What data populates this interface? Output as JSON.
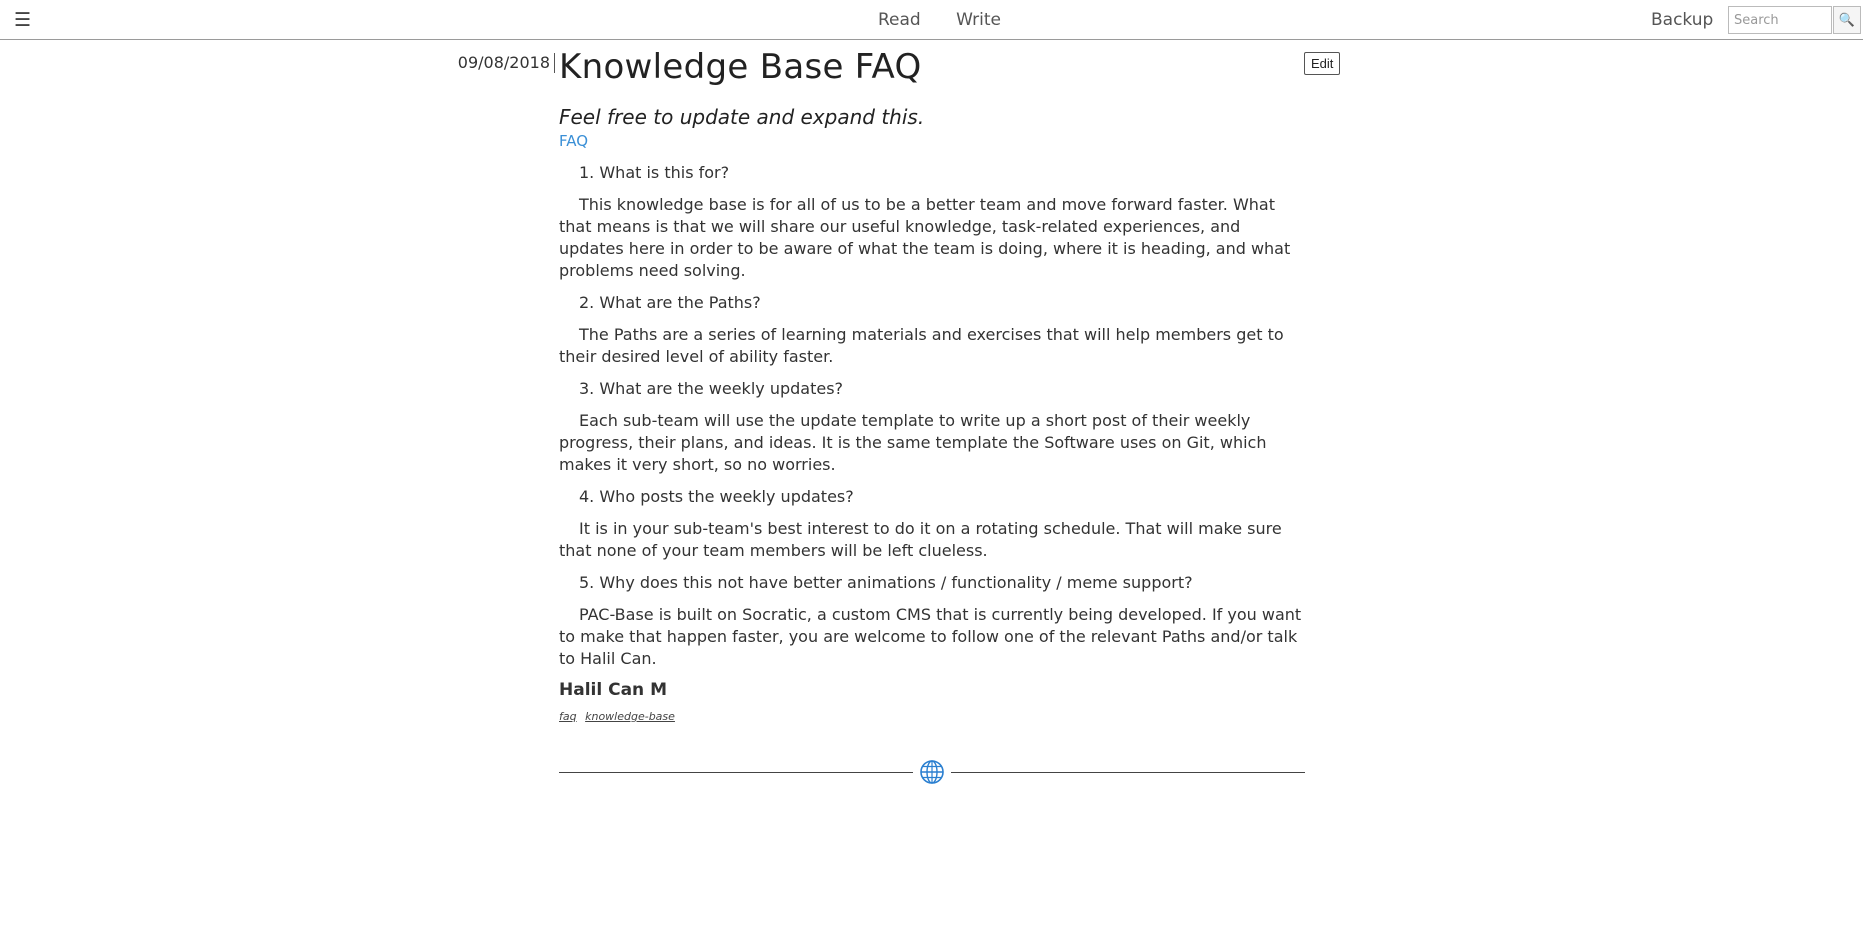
{
  "header": {
    "menu_icon": "☰",
    "nav": [
      "Read",
      "Write"
    ],
    "backup_label": "Backup",
    "search_placeholder": "Search",
    "search_icon": "🔍"
  },
  "post": {
    "date": "09/08/2018",
    "title": "Knowledge Base FAQ",
    "edit_label": "Edit",
    "subtitle": "Feel free to update and expand this.",
    "category": "FAQ",
    "faq": [
      {
        "q": "1. What is this for?",
        "a": "This knowledge base is for all of us to be a better team and move forward faster. What that means is that we will share our useful knowledge, task-related experiences, and updates here in order to be aware of what the team is doing, where it is heading, and what problems need solving."
      },
      {
        "q": "2. What are the Paths?",
        "a": "The Paths are a series of learning materials and exercises that will help members get to their desired level of ability faster."
      },
      {
        "q": "3. What are the weekly updates?",
        "a": "Each sub-team will use the update template to write up a short post of their weekly progress, their plans, and ideas. It is the same template the Software uses on Git, which makes it very short, so no worries."
      },
      {
        "q": "4. Who posts the weekly updates?",
        "a": "It is in your sub-team's best interest to do it on a rotating schedule. That will make sure that none of your team members will be left clueless."
      },
      {
        "q": "5. Why does this not have better animations / functionality / meme support?",
        "a": "PAC-Base is built on Socratic, a custom CMS that is currently being developed. If you want to make that happen faster, you are welcome to follow one of the relevant Paths and/or talk to Halil Can."
      }
    ],
    "author": "Halil Can M",
    "tags": [
      "faq",
      "knowledge-base"
    ]
  },
  "colors": {
    "link": "#3a8fd6",
    "globe": "#2a7fd0"
  }
}
